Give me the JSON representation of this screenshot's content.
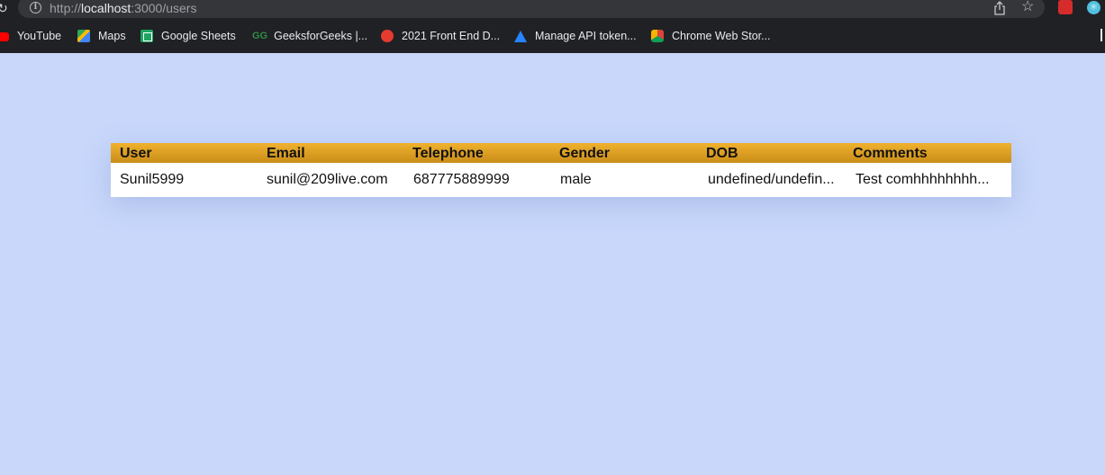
{
  "browser": {
    "url_prefix": "http://",
    "url_host": "localhost",
    "url_path": ":3000/users",
    "bookmarks": [
      {
        "label": "YouTube",
        "icon": "youtube-icon"
      },
      {
        "label": "Maps",
        "icon": "maps-icon"
      },
      {
        "label": "Google Sheets",
        "icon": "sheets-icon"
      },
      {
        "label": "GeeksforGeeks |...",
        "icon": "gfg-icon"
      },
      {
        "label": "2021 Front End D...",
        "icon": "frontend-icon"
      },
      {
        "label": "Manage API token...",
        "icon": "atlassian-icon"
      },
      {
        "label": "Chrome Web Stor...",
        "icon": "chrome-web-store-icon"
      }
    ],
    "gfg_glyph": "GG"
  },
  "table": {
    "headers": [
      "User",
      "Email",
      "Telephone",
      "Gender",
      "DOB",
      "Comments"
    ],
    "rows": [
      [
        "Sunil5999",
        "sunil@209live.com",
        "687775889999",
        "male",
        "undefined/undefin...",
        "Test comhhhhhhhh..."
      ]
    ],
    "header_color": "#e0a024",
    "background_color": "#c8d7fa"
  }
}
